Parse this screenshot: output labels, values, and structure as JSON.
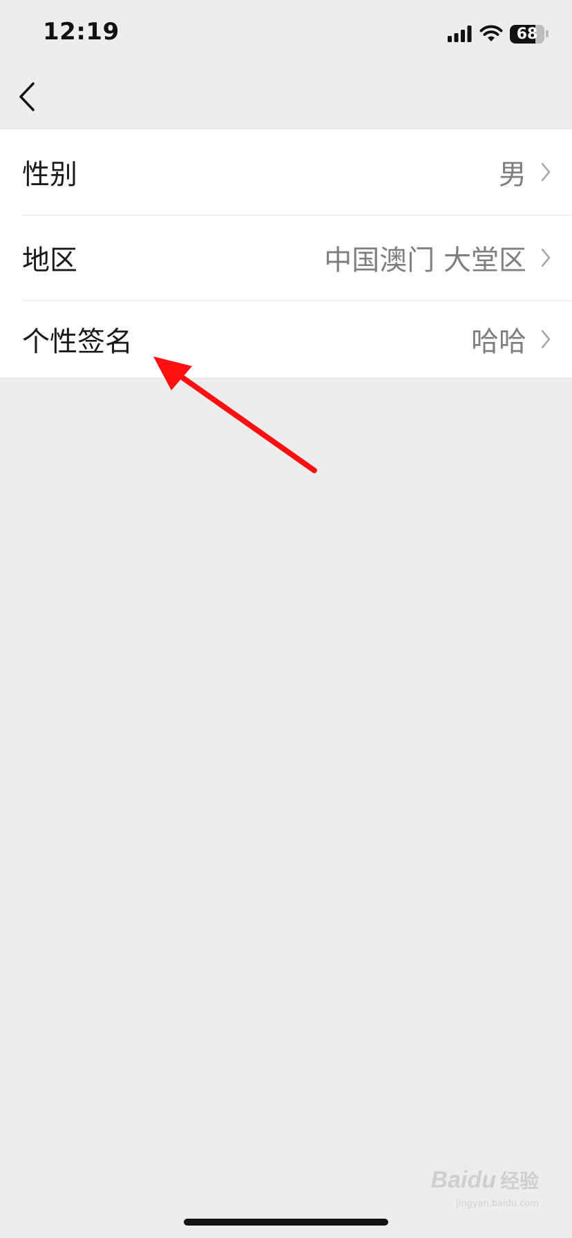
{
  "status_bar": {
    "time": "12:19",
    "battery": "68"
  },
  "nav": {
    "back_icon": "chevron-left-icon"
  },
  "settings": {
    "rows": [
      {
        "label": "性别",
        "value": "男"
      },
      {
        "label": "地区",
        "value": "中国澳门 大堂区"
      },
      {
        "label": "个性签名",
        "value": "哈哈"
      }
    ]
  },
  "annotation": {
    "color": "#ff1010"
  },
  "watermark": {
    "logo": "Baidu",
    "text": "经验",
    "url": "jingyan.baidu.com"
  },
  "colors": {
    "background": "#ededed",
    "list_background": "#ffffff",
    "value_text": "#7f7f7f"
  }
}
